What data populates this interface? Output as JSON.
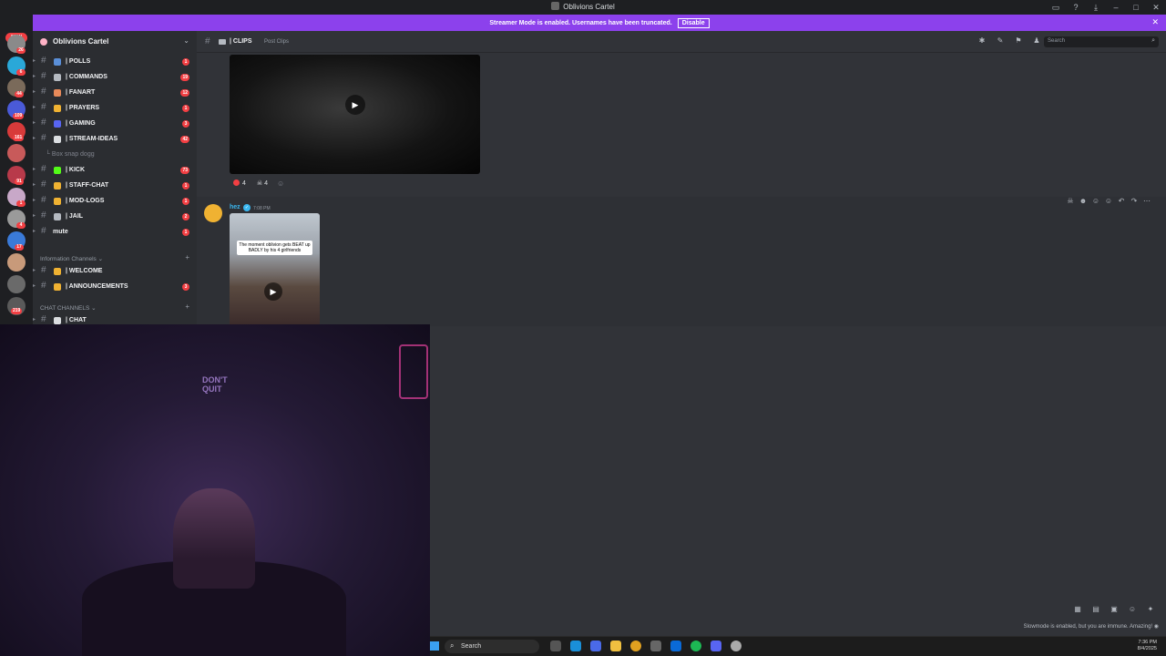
{
  "window": {
    "title": "Oblivions Cartel"
  },
  "banner": {
    "message": "Streamer Mode is enabled. Usernames have been truncated.",
    "disable_label": "Disable"
  },
  "guilds": {
    "new_label": "NEW",
    "badges": [
      "26",
      "6",
      "44",
      "109",
      "161",
      "91",
      "1",
      "4",
      "17",
      "219"
    ]
  },
  "server": {
    "name": "Oblivions Cartel"
  },
  "channels": [
    {
      "label": "| POLLS",
      "badge": "1",
      "color": "#5a8fd8"
    },
    {
      "label": "| COMMANDS",
      "badge": "19",
      "color": "#b5bac1"
    },
    {
      "label": "| FANART",
      "badge": "12",
      "color": "#e88a5a"
    },
    {
      "label": "| PRAYERS",
      "badge": "1",
      "color": "#f0b232"
    },
    {
      "label": "| GAMING",
      "badge": "3",
      "color": "#5865f2"
    },
    {
      "label": "| STREAM-IDEAS",
      "badge": "42",
      "color": "#dbdee1"
    },
    {
      "label": "| KICK",
      "badge": "73",
      "color": "#53fc18"
    },
    {
      "label": "| STAFF-CHAT",
      "badge": "1",
      "color": "#f0b232"
    },
    {
      "label": "| MOD-LOGS",
      "badge": "1",
      "color": "#f0b232"
    },
    {
      "label": "| JAIL",
      "badge": "2",
      "color": "#b5bac1"
    },
    {
      "label": "mute",
      "badge": "1",
      "color": ""
    }
  ],
  "thread": {
    "label": "Box snap dogg"
  },
  "categories": {
    "info": {
      "label": "Information Channels"
    },
    "chat": {
      "label": "CHAT CHANNELS"
    }
  },
  "info_channels": [
    {
      "label": "| WELCOME",
      "badge": "",
      "color": "#f0b232"
    },
    {
      "label": "| ANNOUNCEMENTS",
      "badge": "3",
      "color": "#f0b232"
    }
  ],
  "chat_channels": [
    {
      "label": "| CHAT",
      "badge": "",
      "color": "#dbdee1"
    }
  ],
  "channel_header": {
    "name": "| CLIPS",
    "subtitle": "Post Clips",
    "search_placeholder": "Search"
  },
  "reactions": [
    {
      "emoji": "red-circle",
      "count": "4",
      "color": "#f23f43"
    },
    {
      "emoji": "skull",
      "count": "4",
      "color": "#dbdee1"
    }
  ],
  "message": {
    "author": "hez",
    "time": "7:08 PM",
    "thumbnail_caption": "The moment oblivion gets BEAT up BADLY by his 4 girlfriends"
  },
  "webcam": {
    "neon_text": "DON'T QUIT"
  },
  "status": {
    "slowmode": "Slowmode is enabled, but you are immune. Amazing!"
  },
  "taskbar": {
    "search_label": "Search",
    "time": "7:36 PM",
    "date": "8/4/2025"
  }
}
